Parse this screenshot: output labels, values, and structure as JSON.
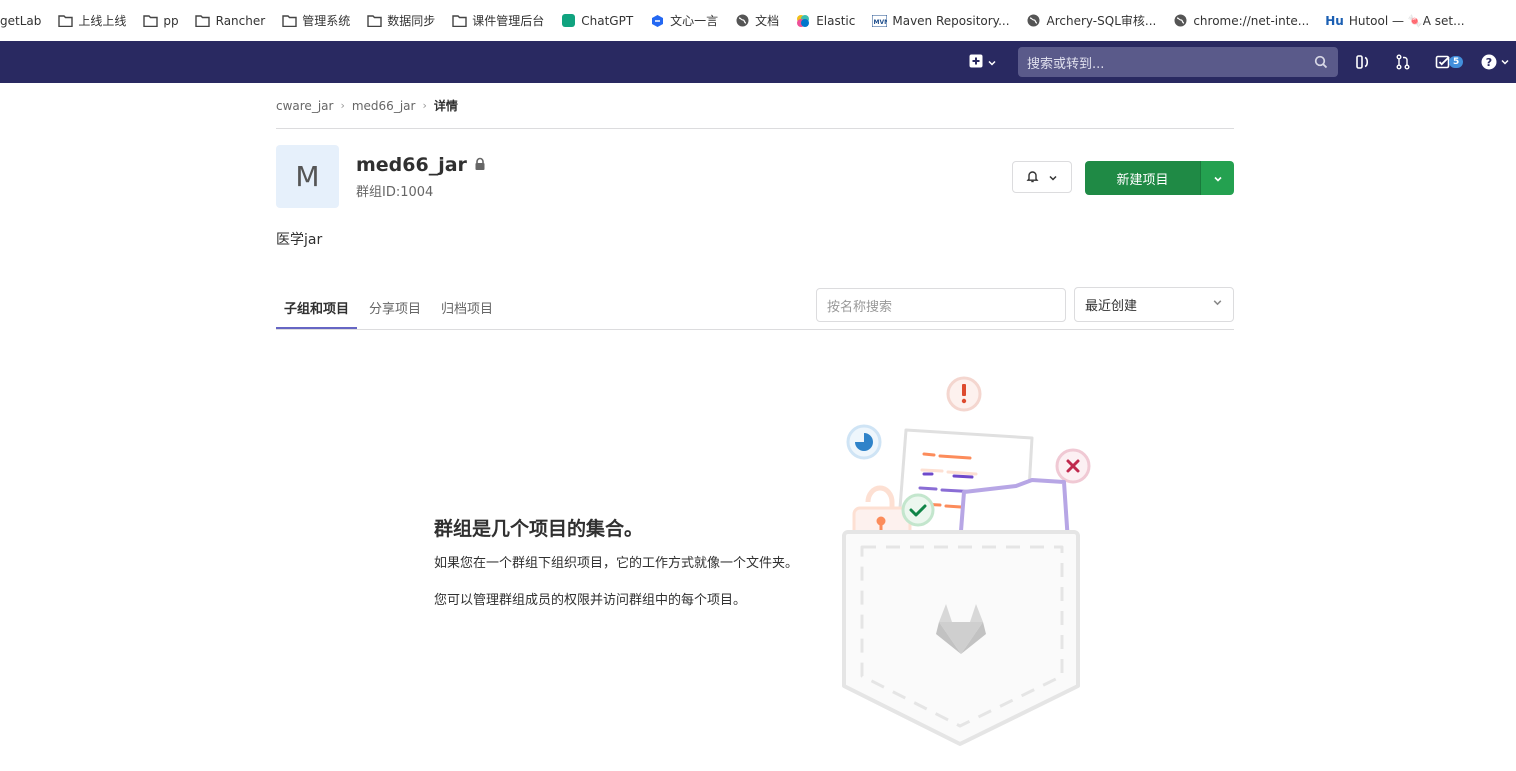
{
  "bookmarks": [
    {
      "label": "getLab",
      "icon": "none"
    },
    {
      "label": "上线上线",
      "icon": "folder-icon"
    },
    {
      "label": "pp",
      "icon": "folder-icon"
    },
    {
      "label": "Rancher",
      "icon": "folder-icon"
    },
    {
      "label": "管理系统",
      "icon": "folder-icon"
    },
    {
      "label": "数据同步",
      "icon": "folder-icon"
    },
    {
      "label": "课件管理后台",
      "icon": "folder-icon"
    },
    {
      "label": "ChatGPT",
      "icon": "chatgpt-icon",
      "color": "#10a37f"
    },
    {
      "label": "文心一言",
      "icon": "wenxin-icon",
      "color": "#2468f2"
    },
    {
      "label": "文档",
      "icon": "globe-icon",
      "color": "#555555"
    },
    {
      "label": "Elastic",
      "icon": "elastic-icon",
      "color": "#f0bf1a"
    },
    {
      "label": "Maven Repository...",
      "icon": "mvn-icon",
      "color": "#1e4e8c"
    },
    {
      "label": "Archery-SQL审核...",
      "icon": "globe-icon",
      "color": "#555555"
    },
    {
      "label": "chrome://net-inte...",
      "icon": "globe-icon",
      "color": "#555555"
    },
    {
      "label": "Hutool — 🍬A set...",
      "icon": "hutool-icon",
      "color": "#1b5fb3"
    }
  ],
  "nav": {
    "search_placeholder": "搜索或转到...",
    "todo_count": "5",
    "bg": "#292961"
  },
  "breadcrumb": {
    "items": [
      "cware_jar",
      "med66_jar",
      "详情"
    ]
  },
  "group": {
    "avatar_letter": "M",
    "name": "med66_jar",
    "id_label": "群组ID:1004",
    "description": "医学jar"
  },
  "actions": {
    "new_project": "新建项目",
    "primary_color": "#1f8a45"
  },
  "tabs": [
    {
      "label": "子组和项目",
      "active": true
    },
    {
      "label": "分享项目",
      "active": false
    },
    {
      "label": "归档项目",
      "active": false
    }
  ],
  "filter": {
    "placeholder": "按名称搜索",
    "sort_selected": "最近创建"
  },
  "empty_state": {
    "title": "群组是几个项目的集合。",
    "line1": "如果您在一个群组下组织项目，它的工作方式就像一个文件夹。",
    "line2": "您可以管理群组成员的权限并访问群组中的每个项目。"
  }
}
